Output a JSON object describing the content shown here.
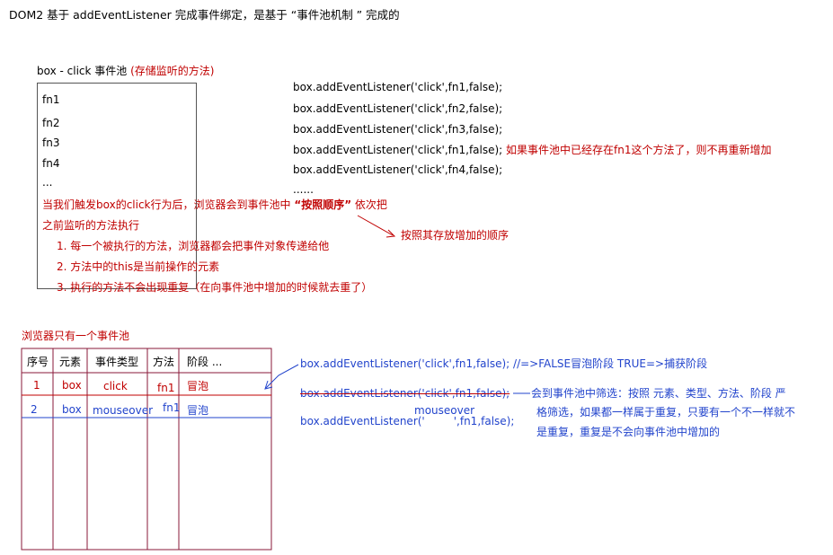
{
  "header": {
    "intro": "DOM2 基于 addEventListener  完成事件绑定，是基于 “事件池机制 ” 完成的"
  },
  "pool": {
    "title": "box - click  事件池",
    "title_note": "(存储监听的方法)",
    "items": [
      "fn1",
      "fn2",
      "fn3",
      "fn4",
      "..."
    ]
  },
  "code_lines": [
    "box.addEventListener('click',fn1,false);",
    "box.addEventListener('click',fn2,false);",
    "box.addEventListener('click',fn3,false);",
    "box.addEventListener('click',fn1,false);",
    "box.addEventListener('click',fn4,false);",
    "......"
  ],
  "code_note": "如果事件池中已经存在fn1这个方法了，则不再重新增加",
  "trigger": {
    "line1_pre": "当我们触发box的click行为后，浏览器会到事件池中 ",
    "line1_bold": "“按照顺序”",
    "line1_post": " 依次把",
    "line2": "之前监听的方法执行",
    "points": [
      "1. 每一个被执行的方法，浏览器都会把事件对象传递给他",
      "2. 方法中的this是当前操作的元素",
      "3. 执行的方法不会出现重复（在向事件池中增加的时候就去重了）"
    ],
    "order_note": "按照其存放增加的顺序"
  },
  "browser_pool": {
    "title": "浏览器只有一个事件池",
    "headers": [
      "序号",
      "元素",
      "事件类型",
      "方法",
      "阶段 ..."
    ],
    "rows": [
      [
        "1",
        "box",
        "click",
        "fn1",
        "冒泡"
      ],
      [
        "2",
        "box",
        "mouseover",
        "fn1",
        "冒泡"
      ]
    ]
  },
  "right_notes": {
    "line1": "box.addEventListener('click',fn1,false);  //=>FALSE冒泡阶段  TRUE=>捕获阶段",
    "line2_struck": "box.addEventListener('click',fn1,false);",
    "line3_mouseover": "mouseover",
    "line3_pre": "box.addEventListener('",
    "line3_post": "',fn1,false);",
    "dedupe_lines": [
      "会到事件池中筛选：按照 元素、类型、方法、阶段 严",
      "格筛选，如果都一样属于重复，只要有一个不一样就不",
      "是重复，重复是不会向事件池中增加的"
    ]
  },
  "colors": {
    "red": "#c00000",
    "dark_purple": "#3a1a6a",
    "blue": "#2244cc",
    "box_border": "#555555"
  }
}
